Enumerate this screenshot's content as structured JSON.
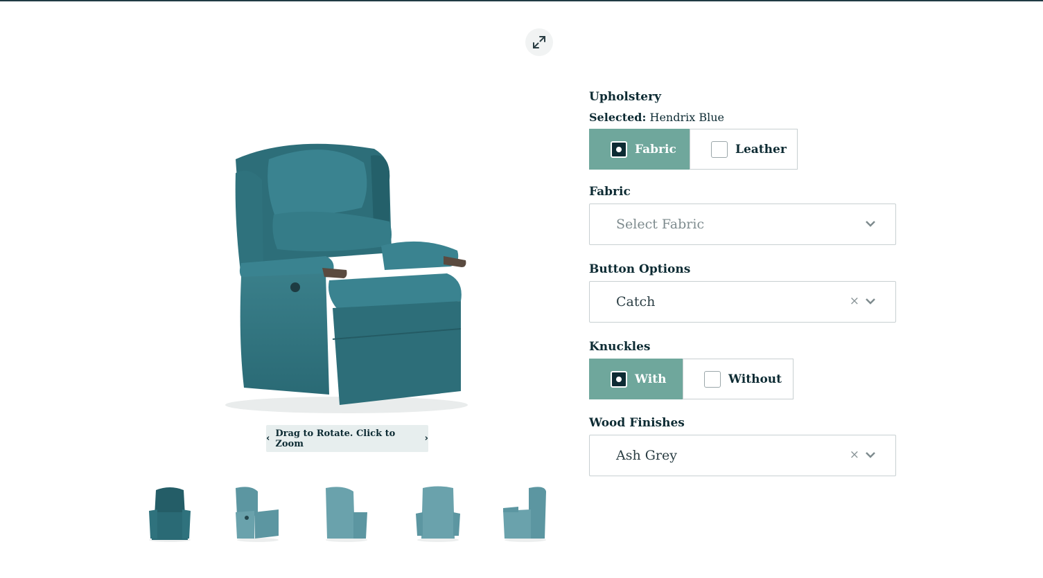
{
  "viewer": {
    "expand_icon": "expand-arrows-icon",
    "rotate_hint": {
      "left_icon": "chevron-left-icon",
      "text": "Drag to Rotate. Click to Zoom",
      "right_icon": "chevron-right-icon"
    },
    "thumbnails": [
      "front-view",
      "side-angle-view",
      "rear-angle-view",
      "rear-view",
      "side-view"
    ]
  },
  "colors": {
    "accent": "#6fa79c",
    "text": "#0d2b33",
    "upholstery": "#2e6f7a"
  },
  "options": {
    "upholstery": {
      "title": "Upholstery",
      "selected_label": "Selected:",
      "selected_value": "Hendrix Blue",
      "choices": [
        {
          "label": "Fabric",
          "active": true
        },
        {
          "label": "Leather",
          "active": false
        }
      ]
    },
    "fabric": {
      "title": "Fabric",
      "placeholder": "Select Fabric"
    },
    "button_options": {
      "title": "Button Options",
      "value": "Catch"
    },
    "knuckles": {
      "title": "Knuckles",
      "choices": [
        {
          "label": "With",
          "active": true
        },
        {
          "label": "Without",
          "active": false
        }
      ]
    },
    "wood_finishes": {
      "title": "Wood Finishes",
      "value": "Ash Grey"
    }
  }
}
